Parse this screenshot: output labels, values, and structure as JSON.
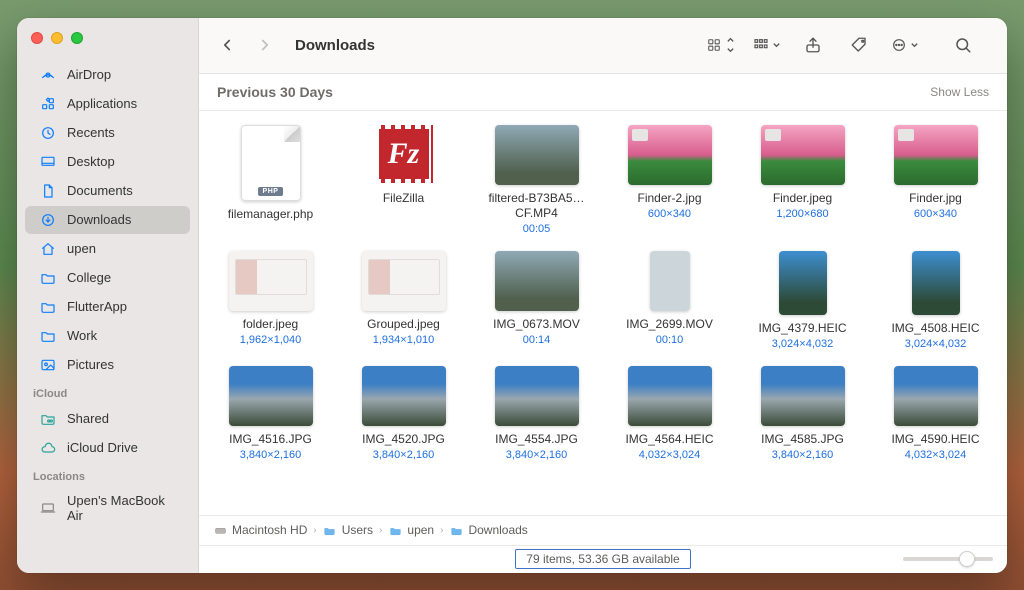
{
  "window": {
    "title": "Downloads"
  },
  "sidebar": {
    "favorites": [
      {
        "label": "AirDrop",
        "icon": "airdrop"
      },
      {
        "label": "Applications",
        "icon": "apps"
      },
      {
        "label": "Recents",
        "icon": "clock"
      },
      {
        "label": "Desktop",
        "icon": "desktop"
      },
      {
        "label": "Documents",
        "icon": "doc"
      },
      {
        "label": "Downloads",
        "icon": "download",
        "selected": true
      },
      {
        "label": "upen",
        "icon": "home"
      },
      {
        "label": "College",
        "icon": "folder"
      },
      {
        "label": "FlutterApp",
        "icon": "folder"
      },
      {
        "label": "Work",
        "icon": "folder"
      },
      {
        "label": "Pictures",
        "icon": "image"
      }
    ],
    "icloud_label": "iCloud",
    "icloud": [
      {
        "label": "Shared",
        "icon": "shared"
      },
      {
        "label": "iCloud Drive",
        "icon": "cloud"
      }
    ],
    "locations_label": "Locations",
    "locations": [
      {
        "label": "Upen's MacBook Air",
        "icon": "laptop"
      }
    ]
  },
  "section": {
    "title": "Previous 30 Days",
    "toggle": "Show Less"
  },
  "files": [
    {
      "name": "filemanager.php",
      "meta": "",
      "thumb": "php"
    },
    {
      "name": "FileZilla",
      "meta": "",
      "thumb": "filezilla"
    },
    {
      "name": "filtered-B73BA5…CF.MP4",
      "meta": "00:05",
      "thumb": "video-landscape"
    },
    {
      "name": "Finder-2.jpg",
      "meta": "600×340",
      "thumb": "screenshot"
    },
    {
      "name": "Finder.jpeg",
      "meta": "1,200×680",
      "thumb": "screenshot"
    },
    {
      "name": "Finder.jpg",
      "meta": "600×340",
      "thumb": "screenshot"
    },
    {
      "name": "folder.jpeg",
      "meta": "1,962×1,040",
      "thumb": "ui"
    },
    {
      "name": "Grouped.jpeg",
      "meta": "1,934×1,010",
      "thumb": "ui"
    },
    {
      "name": "IMG_0673.MOV",
      "meta": "00:14",
      "thumb": "video-landscape"
    },
    {
      "name": "IMG_2699.MOV",
      "meta": "00:10",
      "thumb": "video-portrait"
    },
    {
      "name": "IMG_4379.HEIC",
      "meta": "3,024×4,032",
      "thumb": "portrait"
    },
    {
      "name": "IMG_4508.HEIC",
      "meta": "3,024×4,032",
      "thumb": "portrait"
    },
    {
      "name": "IMG_4516.JPG",
      "meta": "3,840×2,160",
      "thumb": "mountain"
    },
    {
      "name": "IMG_4520.JPG",
      "meta": "3,840×2,160",
      "thumb": "mountain"
    },
    {
      "name": "IMG_4554.JPG",
      "meta": "3,840×2,160",
      "thumb": "mountain"
    },
    {
      "name": "IMG_4564.HEIC",
      "meta": "4,032×3,024",
      "thumb": "mountain"
    },
    {
      "name": "IMG_4585.JPG",
      "meta": "3,840×2,160",
      "thumb": "mountain"
    },
    {
      "name": "IMG_4590.HEIC",
      "meta": "4,032×3,024",
      "thumb": "mountain"
    }
  ],
  "path": [
    {
      "label": "Macintosh HD",
      "icon": "hdd"
    },
    {
      "label": "Users",
      "icon": "folder"
    },
    {
      "label": "upen",
      "icon": "folder"
    },
    {
      "label": "Downloads",
      "icon": "folder"
    }
  ],
  "status": "79 items, 53.36 GB available"
}
